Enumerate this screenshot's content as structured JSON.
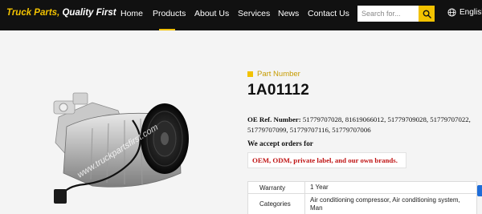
{
  "header": {
    "logo_part1": "Truck Parts,",
    "logo_part2": "Quality First",
    "nav": [
      "Home",
      "Products",
      "About Us",
      "Services",
      "News",
      "Contact Us"
    ],
    "active_nav": "Products",
    "search_placeholder": "Search for...",
    "language": "English"
  },
  "product": {
    "watermark": "www.truckpartsfirst.com",
    "section_label": "Part Number",
    "part_number": "1A01112",
    "oe_label": "OE Ref. Number:",
    "oe_numbers": "51779707028, 81619066012, 51779709028, 51779707022, 51779707099, 51779707116, 51779707006",
    "accept_text": "We accept orders for",
    "brand_text": "OEM, ODM, private label, and our own brands.",
    "specs": [
      {
        "key": "Warranty",
        "value": "1 Year"
      },
      {
        "key": "Categories",
        "value": "Air conditioning compressor, Air conditioning system, Man"
      }
    ]
  },
  "colors": {
    "accent": "#f2c200",
    "header_bg": "#111111",
    "brand_red": "#c01515",
    "page_bg": "#f4f4f4"
  }
}
